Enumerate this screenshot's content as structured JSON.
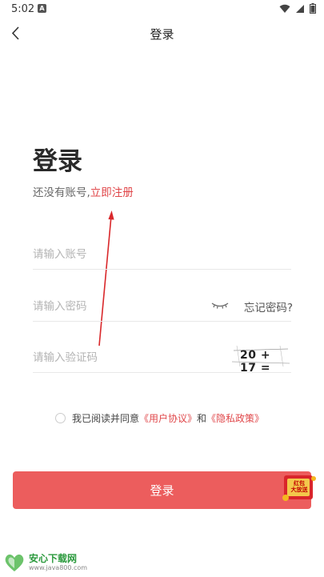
{
  "status": {
    "time": "5:02",
    "notification_badge": "A",
    "icons": [
      "wifi-icon",
      "signal-icon",
      "battery-icon"
    ]
  },
  "header": {
    "title": "登录",
    "back_icon": "chevron-left-icon"
  },
  "main": {
    "title": "登录",
    "register_prompt": "还没有账号,",
    "register_link": "立即注册"
  },
  "form": {
    "account": {
      "placeholder": "请输入账号",
      "value": ""
    },
    "password": {
      "placeholder": "请输入密码",
      "value": "",
      "toggle_icon": "eye-closed-icon",
      "forgot_label": "忘记密码?"
    },
    "captcha": {
      "placeholder": "请输入验证码",
      "value": "",
      "challenge": "20 + 17 ="
    }
  },
  "agreement": {
    "prefix": "我已阅读并同意",
    "user_agreement": "《用户协议》",
    "conjunction": "和",
    "privacy_policy": "《隐私政策》",
    "checked": false
  },
  "login_button": {
    "label": "登录"
  },
  "promo": {
    "label_line1": "红包",
    "label_line2": "大放送"
  },
  "watermark": {
    "name": "安心下载网",
    "url": "www.java800.com"
  },
  "colors": {
    "accent": "#e0474a",
    "button": "#ec5d5d",
    "placeholder": "#b3b3b3",
    "divider": "#e8e8e8",
    "watermark_green": "#2c9a3e"
  }
}
